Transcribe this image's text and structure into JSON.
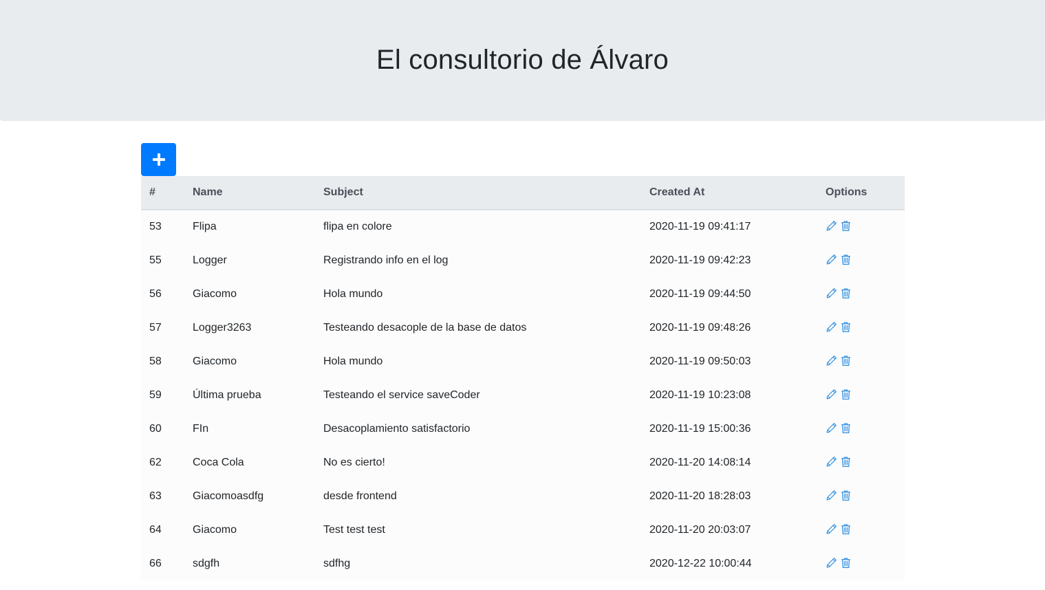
{
  "header": {
    "title": "El consultorio de Álvaro"
  },
  "toolbar": {
    "add_icon": "plus-icon",
    "accent_color": "#007bff"
  },
  "table": {
    "columns": [
      "#",
      "Name",
      "Subject",
      "Created At",
      "Options"
    ],
    "rows": [
      {
        "id": "53",
        "name": "Flipa",
        "subject": "flipa en colore",
        "created_at": "2020-11-19 09:41:17"
      },
      {
        "id": "55",
        "name": "Logger",
        "subject": "Registrando info en el log",
        "created_at": "2020-11-19 09:42:23"
      },
      {
        "id": "56",
        "name": "Giacomo",
        "subject": "Hola mundo",
        "created_at": "2020-11-19 09:44:50"
      },
      {
        "id": "57",
        "name": "Logger3263",
        "subject": "Testeando desacople de la base de datos",
        "created_at": "2020-11-19 09:48:26"
      },
      {
        "id": "58",
        "name": "Giacomo",
        "subject": "Hola mundo",
        "created_at": "2020-11-19 09:50:03"
      },
      {
        "id": "59",
        "name": "Última prueba",
        "subject": "Testeando el service saveCoder",
        "created_at": "2020-11-19 10:23:08"
      },
      {
        "id": "60",
        "name": "FIn",
        "subject": "Desacoplamiento satisfactorio",
        "created_at": "2020-11-19 15:00:36"
      },
      {
        "id": "62",
        "name": "Coca Cola",
        "subject": "No es cierto!",
        "created_at": "2020-11-20 14:08:14"
      },
      {
        "id": "63",
        "name": "Giacomoasdfg",
        "subject": "desde frontend",
        "created_at": "2020-11-20 18:28:03"
      },
      {
        "id": "64",
        "name": "Giacomo",
        "subject": "Test test test",
        "created_at": "2020-11-20 20:03:07"
      },
      {
        "id": "66",
        "name": "sdgfh",
        "subject": "sdfhg",
        "created_at": "2020-12-22 10:00:44"
      }
    ],
    "option_icons": [
      "pencil-icon",
      "trash-icon"
    ],
    "icon_color": "#2f8fe0"
  }
}
